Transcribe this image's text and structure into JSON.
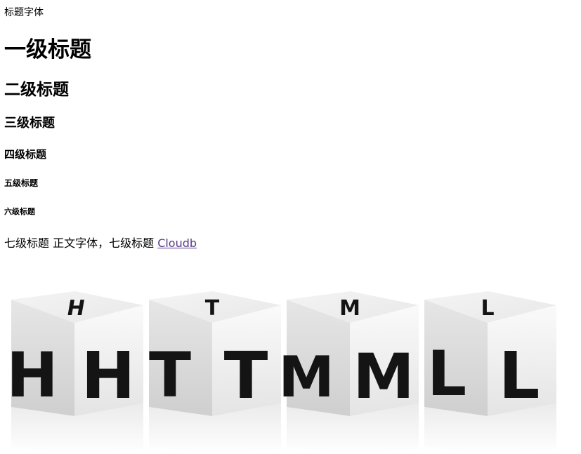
{
  "label": "标题字体",
  "headings": {
    "h1": "一级标题",
    "h2": "二级标题",
    "h3": "三级标题",
    "h4": "四级标题",
    "h5": "五级标题",
    "h6": "六级标题"
  },
  "body": {
    "text": "七级标题 正文字体，七级标题",
    "link_text": "Cloudb"
  },
  "image": {
    "letters": [
      "H",
      "T",
      "M",
      "L"
    ],
    "colors": {
      "cube_top": "#efefef",
      "cube_left": "#dedede",
      "cube_right": "#f6f6f6",
      "letter": "#141414",
      "link": "#5a3a8a"
    }
  }
}
